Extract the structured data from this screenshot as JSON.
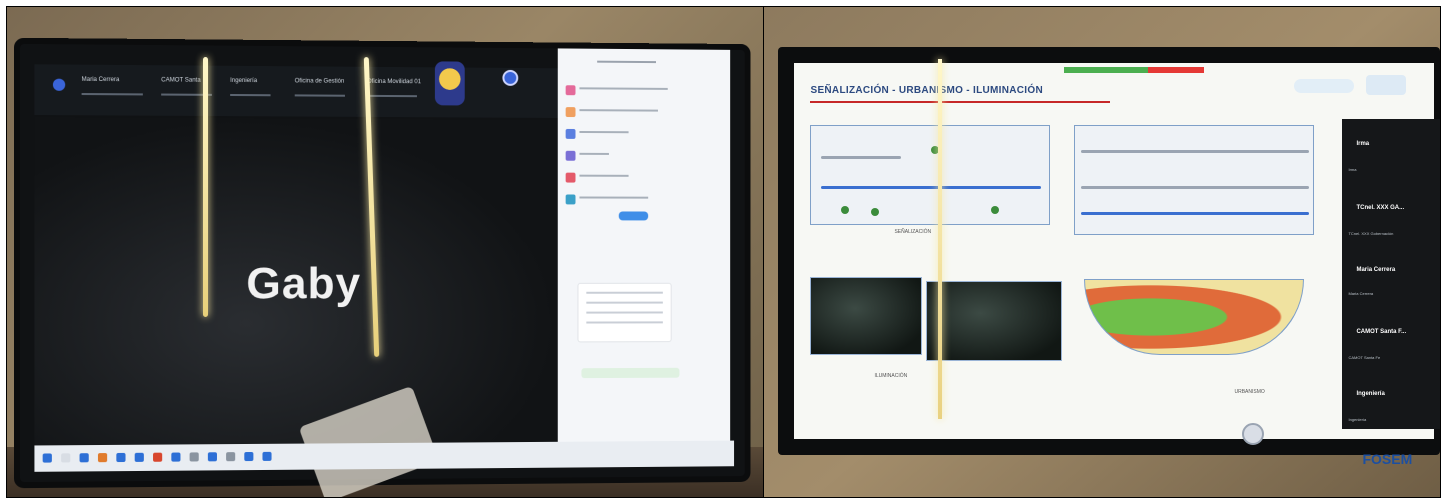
{
  "left_photo": {
    "participant_name": "Gaby",
    "tabs": [
      "Maria Cerrera",
      "CAMOT Santa",
      "Ingeniería",
      "Oficina de Gestión",
      "Oficina Movilidad 01"
    ]
  },
  "right_photo": {
    "slide_title": "SEÑALIZACIÓN - URBANISMO - ILUMINACIÓN",
    "captions": {
      "senalizacion": "SEÑALIZACIÓN",
      "iluminacion": "ILUMINACIÓN",
      "urbanismo": "URBANISMO"
    },
    "participants": [
      {
        "name": "Irma",
        "sub": "Irma"
      },
      {
        "name": "TCnel. XXX GA...",
        "sub": "TCnel. XXX Gobernación"
      },
      {
        "name": "Maria Cerrera",
        "sub": "Maria Cerrera"
      },
      {
        "name": "CAMOT Santa F...",
        "sub": "CAMOT Santa Fe"
      },
      {
        "name": "Ingeniería",
        "sub": "Ingeniería"
      }
    ],
    "brand_text": "FOSEM"
  }
}
